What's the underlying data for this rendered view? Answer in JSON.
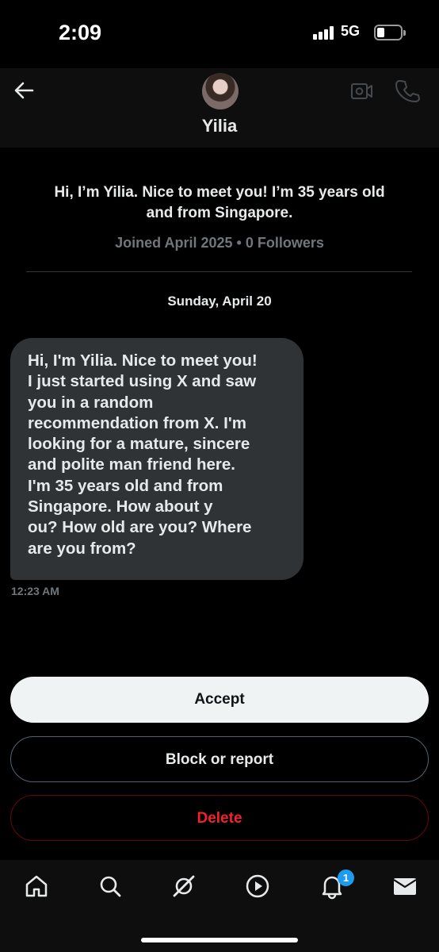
{
  "status_bar": {
    "time": "2:09",
    "network": "5G",
    "icons": [
      "signal-icon",
      "battery-icon"
    ]
  },
  "header": {
    "name": "Yilia",
    "icons": [
      "back-arrow-icon",
      "avatar",
      "video-call-icon",
      "phone-call-icon"
    ]
  },
  "profile": {
    "intro_line1": "Hi, I’m Yilia. Nice to meet you! I’m 35 years old",
    "intro_line2": "and from Singapore.",
    "meta": "Joined April 2025 • 0 Followers"
  },
  "conversation": {
    "date_separator": "Sunday, April 20",
    "message": {
      "lines": [
        "Hi, I'm Yilia. Nice to meet you!",
        "I just started using X and saw",
        "you in a random",
        "recommendation from X. I'm",
        "looking for a mature, sincere",
        "and polite man friend here.",
        "I'm 35 years old and from",
        "Singapore. How about y",
        "ou? How old are you? Where",
        "are you from?"
      ],
      "time": "12:23 AM"
    }
  },
  "actions": {
    "accept": "Accept",
    "block_report": "Block or report",
    "delete": "Delete"
  },
  "bottom_nav": {
    "items": [
      "home-icon",
      "search-icon",
      "grok-icon",
      "video-icon",
      "notifications-icon",
      "messages-icon"
    ],
    "notification_badge": "1"
  },
  "colors": {
    "background": "#000000",
    "bubble": "#2f3336",
    "accent_blue": "#1d9bf0",
    "delete_red": "#f4212e",
    "muted_text": "#71767b"
  }
}
